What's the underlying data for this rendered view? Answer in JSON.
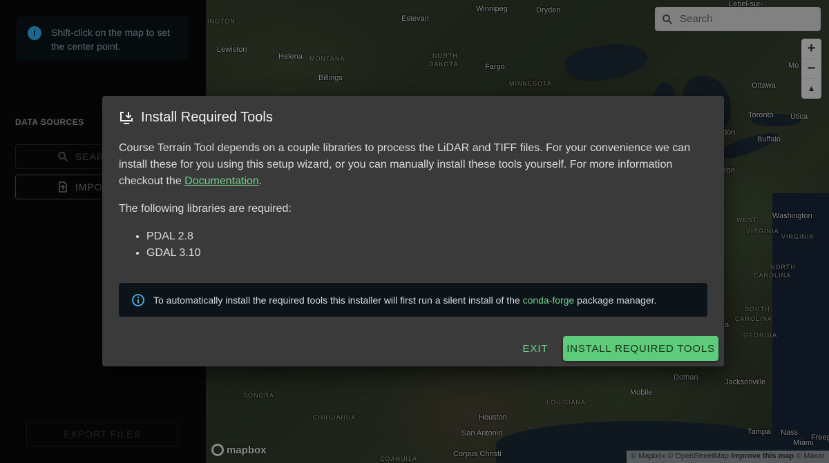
{
  "sidebar": {
    "info_text": "Shift-click on the map to set the center point.",
    "data_sources_label": "DATA SOURCES",
    "search_button_label": "SEAR",
    "import_button_label": "IMPO",
    "export_button_label": "EXPORT FILES"
  },
  "map": {
    "search_placeholder": "Search",
    "zoom_in_label": "+",
    "zoom_out_label": "−",
    "compass_label": "▲",
    "attribution": {
      "mapbox": "© Mapbox",
      "osm": "© OpenStreetMap",
      "improve": "Improve this map",
      "maxar": "© Maxar"
    },
    "logo_text": "mapbox",
    "labels": [
      {
        "text": "Winnipeg",
        "kind": "city"
      },
      {
        "text": "Dryden",
        "kind": "city"
      },
      {
        "text": "Estevan",
        "kind": "city"
      },
      {
        "text": "INGTON",
        "kind": "region"
      },
      {
        "text": "Lewiston",
        "kind": "city"
      },
      {
        "text": "Helena",
        "kind": "city"
      },
      {
        "text": "MONTANA",
        "kind": "region"
      },
      {
        "text": "NORTH",
        "kind": "region"
      },
      {
        "text": "DAKOTA",
        "kind": "region"
      },
      {
        "text": "Fargo",
        "kind": "city"
      },
      {
        "text": "MINNESOTA",
        "kind": "region"
      },
      {
        "text": "Billings",
        "kind": "city"
      },
      {
        "text": "Ottawa",
        "kind": "city"
      },
      {
        "text": "Mo",
        "kind": "city"
      },
      {
        "text": "Toronto",
        "kind": "city"
      },
      {
        "text": "Utica",
        "kind": "city"
      },
      {
        "text": "Buffalo",
        "kind": "city"
      },
      {
        "text": "don",
        "kind": "city"
      },
      {
        "text": "ron",
        "kind": "city"
      },
      {
        "text": "Washington",
        "kind": "city"
      },
      {
        "text": "WEST",
        "kind": "region"
      },
      {
        "text": "VIRGINIA",
        "kind": "region"
      },
      {
        "text": "VIRGINIA",
        "kind": "region"
      },
      {
        "text": "NORTH",
        "kind": "region"
      },
      {
        "text": "CAROLINA",
        "kind": "region"
      },
      {
        "text": "SOUTH",
        "kind": "region"
      },
      {
        "text": "CAROLINA",
        "kind": "region"
      },
      {
        "text": "GEORGIA",
        "kind": "region"
      },
      {
        "text": "ta",
        "kind": "city"
      },
      {
        "text": "Dothan",
        "kind": "city"
      },
      {
        "text": "Jacksonville",
        "kind": "city"
      },
      {
        "text": "Mobile",
        "kind": "city"
      },
      {
        "text": "LOUISIANA",
        "kind": "region"
      },
      {
        "text": "Houston",
        "kind": "city"
      },
      {
        "text": "San Antonio",
        "kind": "city"
      },
      {
        "text": "Corpus Christi",
        "kind": "city"
      },
      {
        "text": "SONORA",
        "kind": "region"
      },
      {
        "text": "CHIHUAHUA",
        "kind": "region"
      },
      {
        "text": "COAHUILA",
        "kind": "region"
      },
      {
        "text": "Tampa",
        "kind": "city"
      },
      {
        "text": "Miami",
        "kind": "city"
      },
      {
        "text": "Nass",
        "kind": "city"
      },
      {
        "text": "Freeport",
        "kind": "city"
      },
      {
        "text": "Lebel-sur-",
        "kind": "city"
      }
    ]
  },
  "modal": {
    "title": "Install Required Tools",
    "intro_before_link": "Course Terrain Tool depends on a couple libraries to process the LiDAR and TIFF files. For your convenience we can install these for you using this setup wizard, or you can manually install these tools yourself. For more information checkout the ",
    "intro_link": "Documentation",
    "intro_after_link": ".",
    "libraries_heading": "The following libraries are required:",
    "libraries": [
      "PDAL 2.8",
      "GDAL 3.10"
    ],
    "alert_before_link": "To automatically install the required tools this installer will first run a silent install of the ",
    "alert_link": "conda-forge",
    "alert_after_link": " package manager.",
    "exit_label": "EXIT",
    "install_label": "INSTALL REQUIRED TOOLS"
  }
}
